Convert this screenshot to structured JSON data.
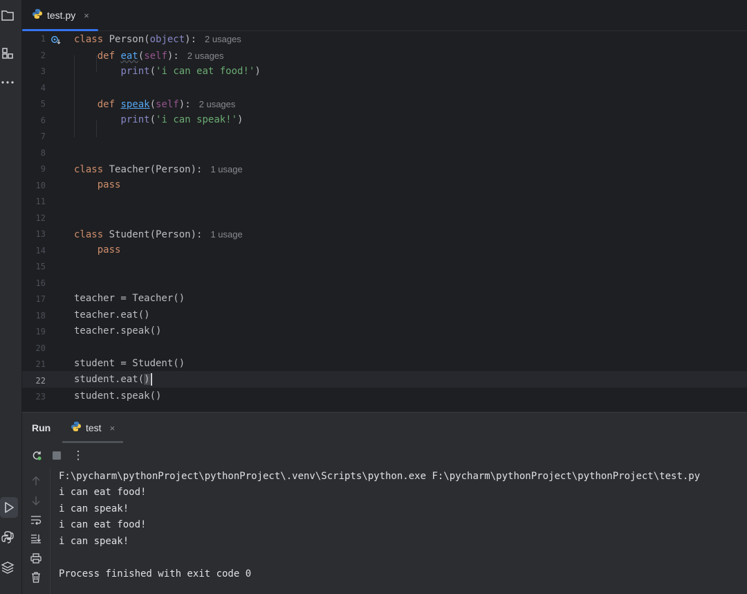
{
  "editor_tab": {
    "filename": "test.py",
    "close": "×"
  },
  "gutter": [
    "1",
    "2",
    "3",
    "4",
    "5",
    "6",
    "7",
    "8",
    "9",
    "10",
    "11",
    "12",
    "13",
    "14",
    "15",
    "16",
    "17",
    "18",
    "19",
    "20",
    "21",
    "22",
    "23"
  ],
  "code": {
    "l1_kw": "class",
    "l1_name": " Person(",
    "l1_base": "object",
    "l1_end": "):",
    "l1_hint": "2 usages",
    "l2_indent": "    ",
    "l2_kw": "def",
    "l2_fn": "eat",
    "l2_open": "(",
    "l2_self": "self",
    "l2_end": "):",
    "l2_hint": "2 usages",
    "l3_indent": "        ",
    "l3_fn": "print",
    "l3_open": "(",
    "l3_str": "'i can eat food!'",
    "l3_end": ")",
    "l5_indent": "    ",
    "l5_kw": "def",
    "l5_fn": "speak",
    "l5_open": "(",
    "l5_self": "self",
    "l5_end": "):",
    "l5_hint": "2 usages",
    "l6_indent": "        ",
    "l6_fn": "print",
    "l6_open": "(",
    "l6_str": "'i can speak!'",
    "l6_end": ")",
    "l9_kw": "class",
    "l9_rest": " Teacher(Person):",
    "l9_hint": "1 usage",
    "l10_indent": "    ",
    "l10_kw": "pass",
    "l13_kw": "class",
    "l13_rest": " Student(Person):",
    "l13_hint": "1 usage",
    "l14_indent": "    ",
    "l14_kw": "pass",
    "l17": "teacher = Teacher()",
    "l18": "teacher.eat()",
    "l19": "teacher.speak()",
    "l21": "student = Student()",
    "l22_a": "student.eat(",
    "l22_b": ")",
    "l23": "student.speak()"
  },
  "run_panel": {
    "title": "Run",
    "tab_label": "test",
    "tab_close": "×",
    "menu": "⋮"
  },
  "console": [
    "F:\\pycharm\\pythonProject\\pythonProject\\.venv\\Scripts\\python.exe F:\\pycharm\\pythonProject\\pythonProject\\test.py",
    "i can eat food!",
    "i can speak!",
    "i can eat food!",
    "i can speak!",
    "",
    "Process finished with exit code 0"
  ],
  "colors": {
    "accent": "#3574f0",
    "keyword": "#cf8e6d",
    "function": "#56a8f5",
    "string": "#6aab73",
    "self": "#94558d",
    "run_green": "#5fb865"
  }
}
